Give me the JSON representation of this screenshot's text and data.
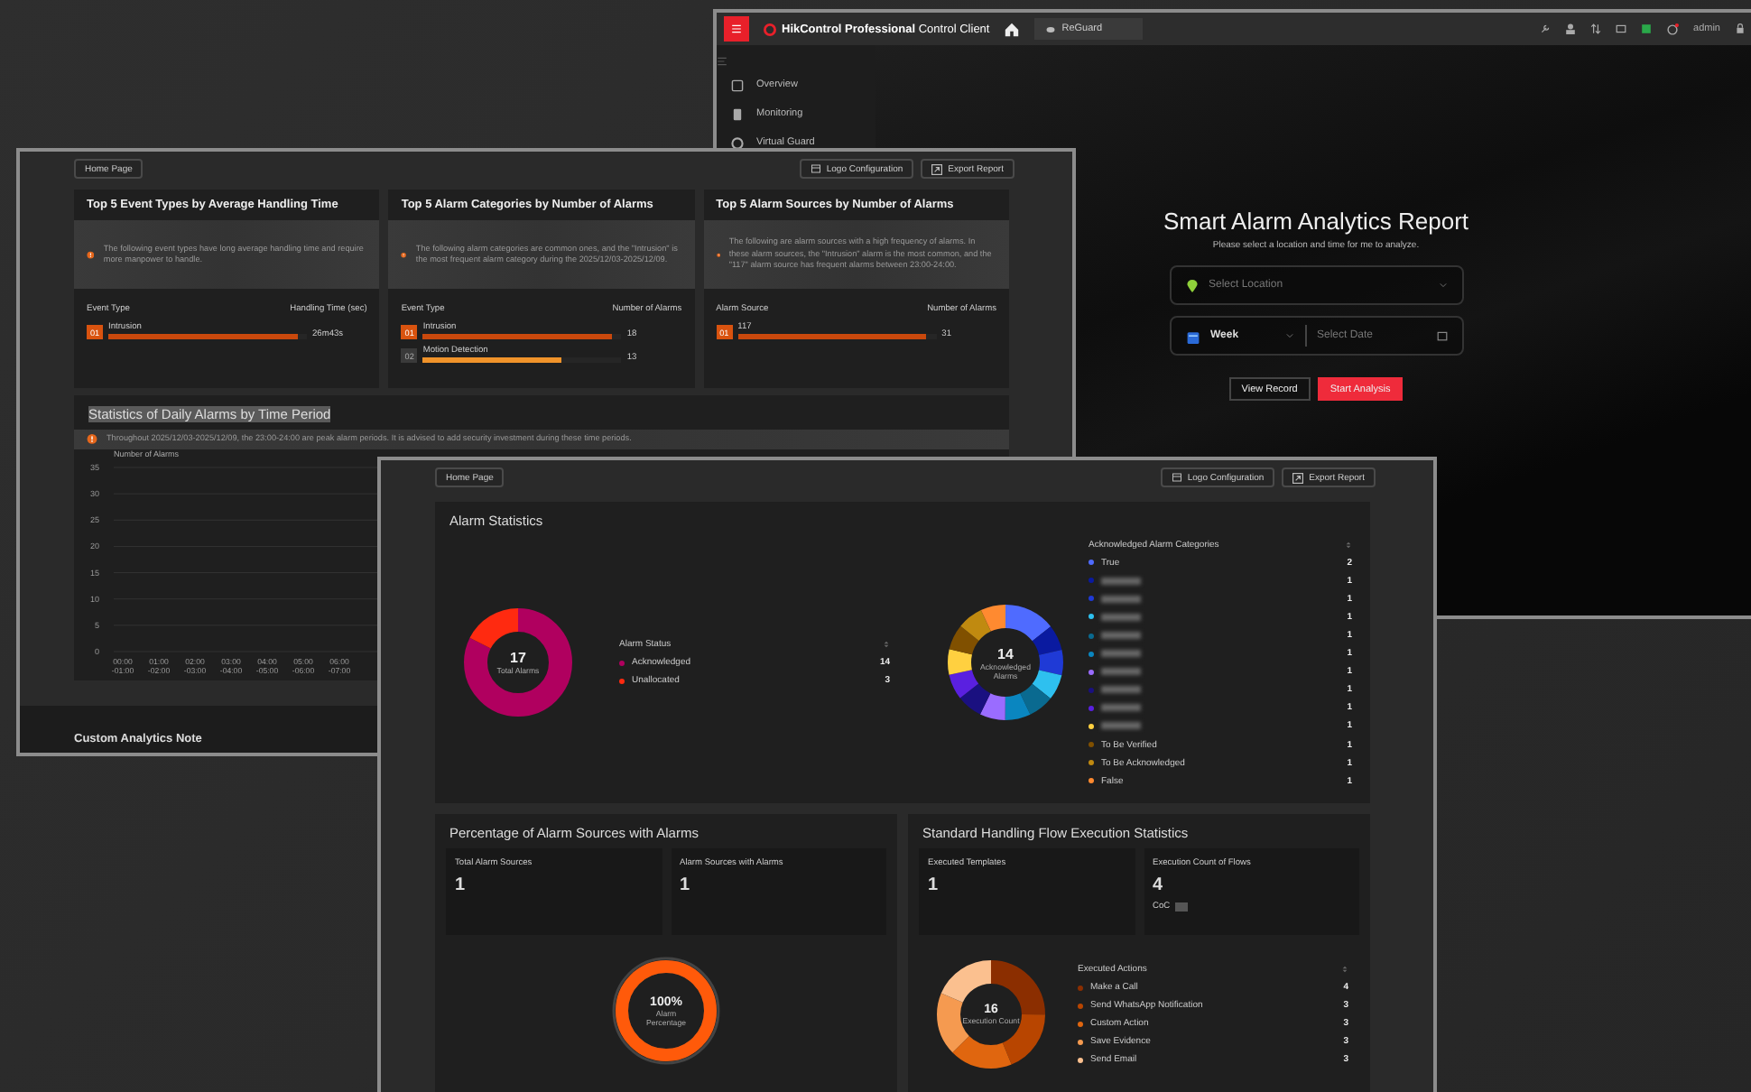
{
  "main_window": {
    "app_title": "**HikControl Professional** Control Client",
    "tab": "ReGuard",
    "user": "admin",
    "sidebar": [
      {
        "label": "Overview",
        "selected": false
      },
      {
        "label": "Monitoring",
        "selected": false
      },
      {
        "label": "Virtual Guard",
        "selected": false
      }
    ],
    "report": {
      "title": "Smart Alarm Analytics Report",
      "subtitle": "Please select a location and time for me to analyze.",
      "location_placeholder": "Select Location",
      "period": "Week",
      "date_placeholder": "Select Date",
      "buttons": [
        {
          "label": "View Record",
          "kind": "secondary"
        },
        {
          "label": "Start Analysis",
          "kind": "primary"
        }
      ]
    }
  },
  "report_window": {
    "home_button": "Home Page",
    "toolbar": [
      {
        "label": "Logo Configuration",
        "kind": "logo"
      },
      {
        "label": "Export Report",
        "kind": "export"
      }
    ],
    "cards": [
      {
        "title": "Top 5 Event Types by Average Handling Time",
        "note": "The following event types have long average handling time and require more manpower to handle.",
        "columns": [
          "Event Type",
          "Handling Time (sec)"
        ],
        "rows": [
          {
            "rank": "01",
            "top": true,
            "label": "Intrusion",
            "value": "26m43s",
            "level": 0.95
          }
        ]
      },
      {
        "title": "Top 5 Alarm Categories by Number of Alarms",
        "note": "The following alarm categories are common ones, and the \"Intrusion\" is the most frequent alarm category during the 2025/12/03-2025/12/09.",
        "columns": [
          "Event Type",
          "Number of Alarms"
        ],
        "rows": [
          {
            "rank": "01",
            "top": true,
            "label": "Intrusion",
            "value": "18",
            "level": 0.95
          },
          {
            "rank": "02",
            "top": false,
            "label": "Motion Detection",
            "value": "13",
            "level": 0.7
          }
        ]
      },
      {
        "title": "Top 5 Alarm Sources by Number of Alarms",
        "note": "The following are alarm sources with a high frequency of alarms. In these alarm sources, the \"Intrusion\" alarm is the most common, and the \"117\" alarm source has frequent alarms between 23:00-24:00.",
        "columns": [
          "Alarm Source",
          "Number of Alarms"
        ],
        "rows": [
          {
            "rank": "01",
            "top": true,
            "label": "117",
            "value": "31",
            "level": 0.95
          }
        ]
      }
    ],
    "daily": {
      "title": "Statistics of Daily Alarms by Time Period",
      "highlighted": true,
      "note": "Throughout 2025/12/03-2025/12/09, the 23:00-24:00 are peak alarm periods. It is advised to add security investment during these time periods.",
      "chart_data": {
        "type": "bar",
        "grid": true,
        "ylabel": "Number of Alarms",
        "categories": [
          "00:00 -01:00",
          "01:00 -02:00",
          "02:00 -03:00",
          "03:00 -04:00",
          "04:00 -05:00",
          "05:00 -06:00",
          "06:00 -07:00"
        ],
        "values": [
          0,
          0,
          0,
          0,
          0,
          0,
          0
        ],
        "ylim": [
          0,
          35
        ],
        "yticks": [
          0,
          5,
          10,
          15,
          20,
          25,
          30,
          35
        ]
      }
    },
    "footer": "Custom Analytics Note"
  },
  "statistics_window": {
    "home_button": "Home Page",
    "toolbar": [
      {
        "label": "Logo Configuration",
        "kind": "logo"
      },
      {
        "label": "Export Report",
        "kind": "export"
      }
    ],
    "alarm_statistics": {
      "title": "Alarm Statistics",
      "total": {
        "value": "17",
        "label": "Total Alarms"
      },
      "status": {
        "title": "Alarm Status",
        "items": [
          {
            "label": "Acknowledged",
            "color": "#b0005f",
            "count": "14"
          },
          {
            "label": "Unallocated",
            "color": "#ff2a10",
            "count": "3"
          }
        ]
      },
      "categories_total": {
        "value": "14",
        "label": "Acknowledged Alarms"
      },
      "categories": {
        "title": "Acknowledged Alarm Categories",
        "items": [
          {
            "label": "True",
            "blurred": false,
            "color": "#4f6bff",
            "count": "2"
          },
          {
            "blurred": true,
            "color": "#0a1aa0",
            "count": "1"
          },
          {
            "blurred": true,
            "color": "#1f3ad6",
            "count": "1"
          },
          {
            "blurred": true,
            "color": "#2ec0ef",
            "count": "1"
          },
          {
            "blurred": true,
            "color": "#0a6a90",
            "count": "1"
          },
          {
            "blurred": true,
            "color": "#0a86c0",
            "count": "1"
          },
          {
            "blurred": true,
            "color": "#9a6cff",
            "count": "1"
          },
          {
            "blurred": true,
            "color": "#1a1080",
            "count": "1"
          },
          {
            "blurred": true,
            "color": "#5a20e0",
            "count": "1"
          },
          {
            "blurred": true,
            "color": "#ffd040",
            "count": "1"
          },
          {
            "label": "To Be Verified",
            "blurred": false,
            "color": "#805000",
            "count": "1"
          },
          {
            "label": "To Be Acknowledged",
            "blurred": false,
            "color": "#c08a10",
            "count": "1"
          },
          {
            "label": "False",
            "blurred": false,
            "color": "#ff8a30",
            "count": "1"
          }
        ]
      }
    },
    "sources": {
      "title": "Percentage of Alarm Sources with Alarms",
      "tiles": [
        {
          "label": "Total Alarm Sources",
          "value": "1"
        },
        {
          "label": "Alarm Sources with Alarms",
          "value": "1"
        }
      ],
      "ring": {
        "value": "100%",
        "label": "Alarm Percentage",
        "level": 1
      }
    },
    "flows": {
      "title": "Standard Handling Flow Execution Statistics",
      "tiles": [
        {
          "label": "Executed Templates",
          "value": "1"
        },
        {
          "label": "Execution Count of Flows",
          "value": "4",
          "note": "CoC"
        }
      ],
      "total": {
        "value": "16",
        "label": "Execution Count"
      },
      "actions": {
        "title": "Executed Actions",
        "items": [
          {
            "label": "Make a Call",
            "color": "#8b2e00",
            "count": "4"
          },
          {
            "label": "Send WhatsApp Notification",
            "color": "#b84500",
            "count": "3"
          },
          {
            "label": "Custom Action",
            "color": "#e0660f",
            "count": "3"
          },
          {
            "label": "Save Evidence",
            "color": "#f59a50",
            "count": "3"
          },
          {
            "label": "Send Email",
            "color": "#fbc08f",
            "count": "3"
          }
        ]
      }
    }
  }
}
